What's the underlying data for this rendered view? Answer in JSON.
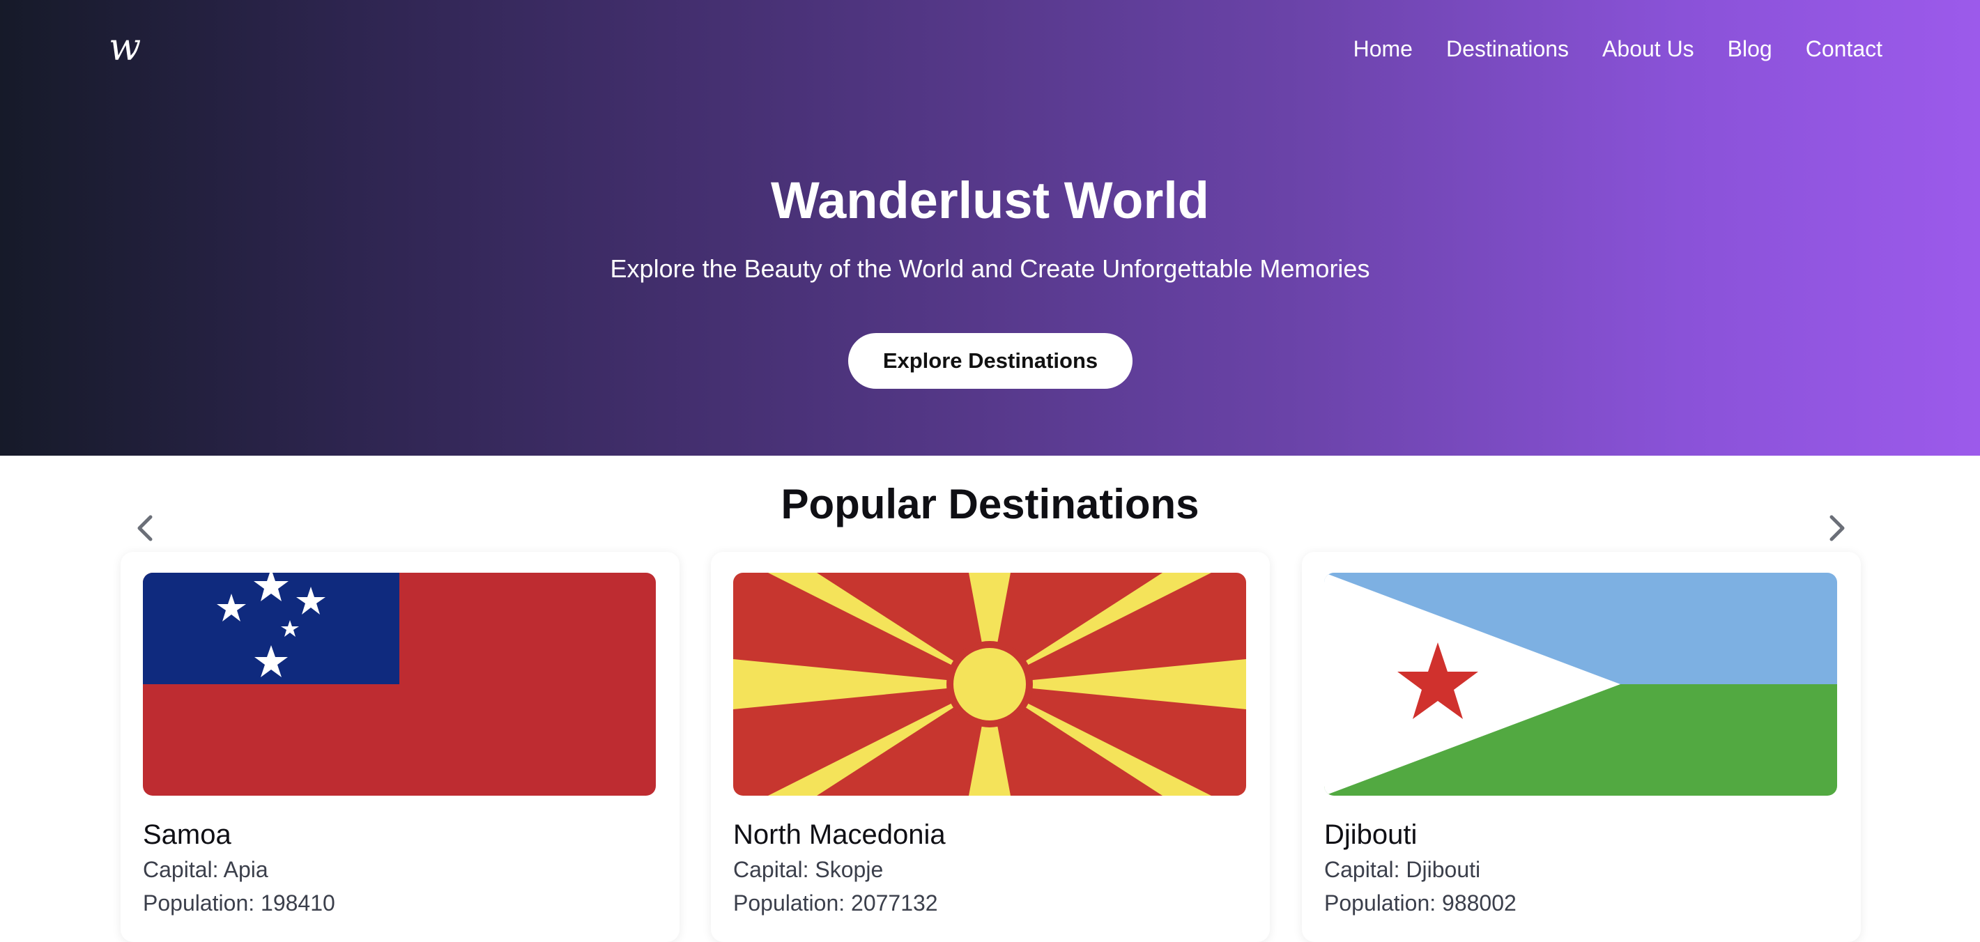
{
  "header": {
    "logo": "w",
    "nav": [
      "Home",
      "Destinations",
      "About Us",
      "Blog",
      "Contact"
    ]
  },
  "hero": {
    "title": "Wanderlust World",
    "subtitle": "Explore the Beauty of the World and Create Unforgettable Memories",
    "cta": "Explore Destinations"
  },
  "destinations": {
    "title": "Popular Destinations",
    "prev_icon": "chevron-left-icon",
    "next_icon": "chevron-right-icon",
    "cards": [
      {
        "name": "Samoa",
        "capital": "Capital: Apia",
        "population": "Population: 198410",
        "flag": "samoa-flag"
      },
      {
        "name": "North Macedonia",
        "capital": "Capital: Skopje",
        "population": "Population: 2077132",
        "flag": "north-macedonia-flag"
      },
      {
        "name": "Djibouti",
        "capital": "Capital: Djibouti",
        "population": "Population: 988002",
        "flag": "djibouti-flag"
      }
    ]
  },
  "colors": {
    "hero_gradient_start": "#161a29",
    "hero_gradient_end": "#9c5aeb",
    "samoa_red": "#be2c31",
    "samoa_blue": "#0f2a7e",
    "macedonia_red": "#c7362f",
    "macedonia_yellow": "#f4e35a",
    "djibouti_blue": "#7db0e2",
    "djibouti_green": "#52a941",
    "djibouti_star": "#d0312d"
  }
}
